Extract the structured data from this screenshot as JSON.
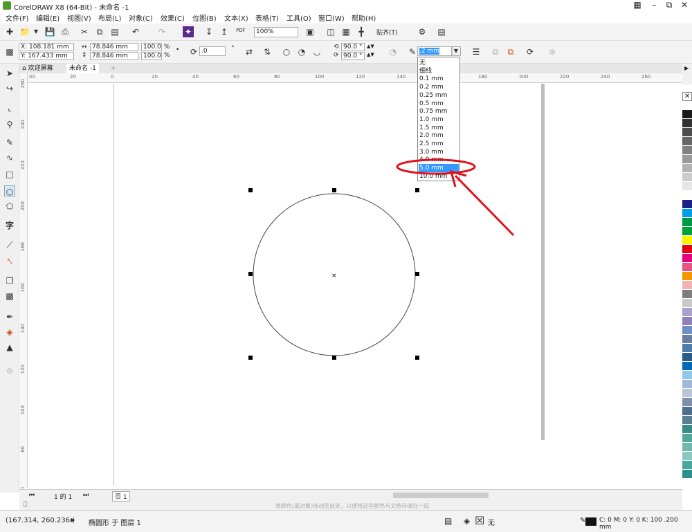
{
  "window": {
    "title": "CorelDRAW X8 (64-Bit) - 未命名 -1"
  },
  "menu": [
    "文件(F)",
    "编辑(E)",
    "视图(V)",
    "布局(L)",
    "对象(C)",
    "效果(C)",
    "位图(B)",
    "文本(X)",
    "表格(T)",
    "工具(O)",
    "窗口(W)",
    "帮助(H)"
  ],
  "toolbar": {
    "pdf_label": "PDF",
    "zoom": "100%",
    "snap_label": "贴齐(T)"
  },
  "properties": {
    "x": "X: 108.181 mm",
    "y": "Y: 167.433 mm",
    "width": "78.846 mm",
    "height": "78.846 mm",
    "scale_w": "100.0",
    "scale_h": "100.0",
    "percent": "%",
    "rotation": ".0",
    "degree_symbol": "°",
    "angle_start": "90.0 °",
    "angle_end": "90.0 °",
    "outline_width": ".2 mm"
  },
  "tabs": [
    "欢迎屏幕",
    "未命名 -1"
  ],
  "ruler_h": [
    "40",
    "20",
    "0",
    "20",
    "40",
    "60",
    "80",
    "100",
    "120",
    "140",
    "160",
    "180",
    "200",
    "220",
    "240",
    "260"
  ],
  "ruler_v": [
    "260",
    "240",
    "220",
    "200",
    "180",
    "160",
    "140",
    "120",
    "100",
    "80",
    "60"
  ],
  "outline_dropdown": {
    "items": [
      "无",
      "细线",
      "0.1 mm",
      "0.2 mm",
      "0.25 mm",
      "0.5 mm",
      "0.75 mm",
      "1.0 mm",
      "1.5 mm",
      "2.0 mm",
      "2.5 mm",
      "3.0 mm",
      "4.0 mm",
      "5.0 mm",
      "10.0 mm"
    ],
    "selected": "5.0 mm",
    "highlight_color": "#3399ff"
  },
  "annotation": {
    "color": "#e0101a"
  },
  "page_nav": {
    "counter": "1 的 1",
    "page_tab": "页 1"
  },
  "hint": "将颜色(或对象)拖动至此处，以便将这些颜色与文档存储在一起",
  "status": {
    "coords": "(167.314, 260.236 )",
    "object_info": "椭圆形 于 图层 1",
    "fill_none": "无",
    "outline_info": "C: 0 M: 0 Y: 0 K: 100  .200 mm"
  },
  "palette_colors": [
    "#ffffff",
    "#1a1a1a",
    "#333333",
    "#4d4d4d",
    "#666666",
    "#808080",
    "#999999",
    "#b3b3b3",
    "#cccccc",
    "#e6e6e6",
    "#ffffff",
    "#1d2088",
    "#00a0e9",
    "#009944",
    "#00a23a",
    "#fff100",
    "#e60012",
    "#e4007f",
    "#e95383",
    "#f39800",
    "#f5b2b2",
    "#7d7d7d",
    "#c9c9c9",
    "#aaa1cc",
    "#8f82bc",
    "#6f8fc7",
    "#6a7fa0",
    "#4e7ca8",
    "#2a5a8a",
    "#0068b7",
    "#8ec9ec",
    "#a3b8d8",
    "#b8c6d8",
    "#7f8fa8",
    "#4f6f90",
    "#5a7d8f",
    "#3a8a8a",
    "#53a89a",
    "#6fb8b0",
    "#8cc8c0",
    "#48a8a0",
    "#2f8f8a"
  ]
}
